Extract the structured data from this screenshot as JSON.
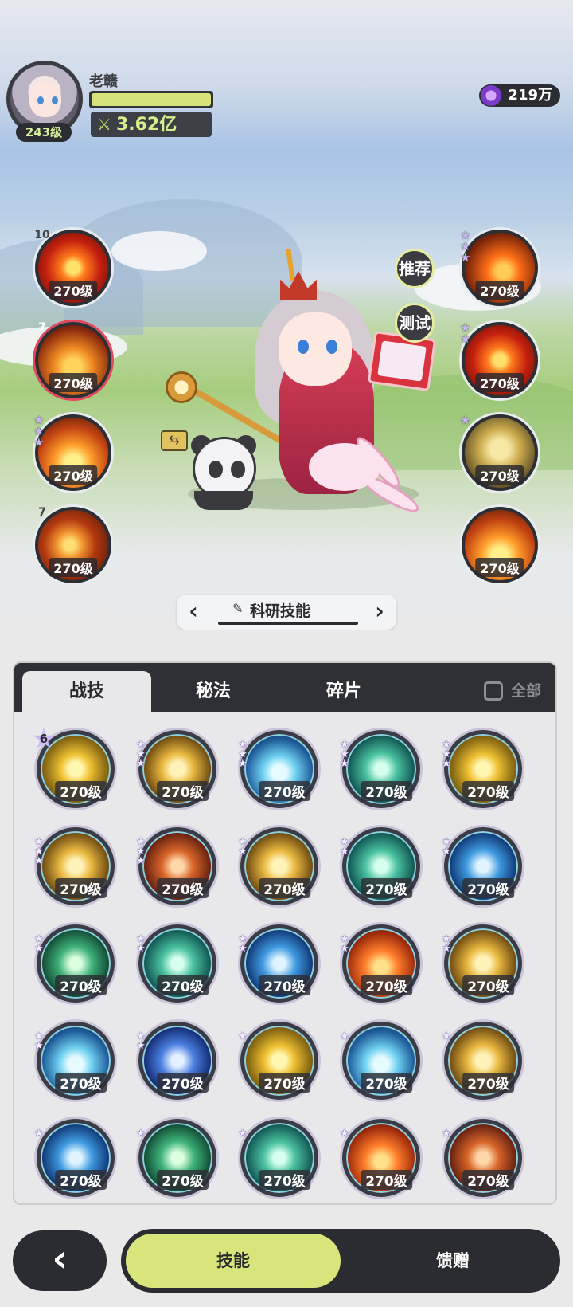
{
  "player": {
    "name": "老赣",
    "level": "243级",
    "power": "3.62亿",
    "currency": "219万"
  },
  "equipped_left": [
    {
      "badge": "10",
      "level": "270级",
      "icon": "fire-burst-icon"
    },
    {
      "badge": "7",
      "level": "270级",
      "icon": "fire-spirit-icon"
    },
    {
      "badge": "",
      "level": "270级",
      "icon": "flame-icon"
    },
    {
      "badge": "7",
      "level": "270级",
      "icon": "fire-vortex-icon"
    }
  ],
  "equipped_right": [
    {
      "level": "270级",
      "icon": "fire-orb-icon"
    },
    {
      "level": "270级",
      "icon": "fire-bird-icon"
    },
    {
      "level": "270级",
      "icon": "shield-icon"
    },
    {
      "level": "270级",
      "icon": "fire-fist-icon"
    }
  ],
  "side_buttons": {
    "recommend": "推荐",
    "test": "测试"
  },
  "switcher": {
    "title": "科研技能",
    "prev": "‹",
    "next": "›"
  },
  "tabs": {
    "items": [
      "战技",
      "秘法",
      "碎片"
    ],
    "active": "战技",
    "all_label": "全部"
  },
  "skills": [
    {
      "badge": "6",
      "level": "270级",
      "icon": "lightning-orb-icon"
    },
    {
      "badge": "",
      "level": "270级",
      "icon": "lightning-dragon-icon"
    },
    {
      "badge": "",
      "level": "270级",
      "icon": "ice-crystal-icon"
    },
    {
      "badge": "",
      "level": "270级",
      "icon": "wind-swirl-icon"
    },
    {
      "badge": "",
      "level": "270级",
      "icon": "star-burst-icon"
    },
    {
      "badge": "",
      "level": "270级",
      "icon": "lightning-strike-icon"
    },
    {
      "badge": "",
      "level": "270级",
      "icon": "meteor-icon"
    },
    {
      "badge": "",
      "level": "270级",
      "icon": "golden-star-icon"
    },
    {
      "badge": "",
      "level": "270级",
      "icon": "wind-arrow-icon"
    },
    {
      "badge": "",
      "level": "270级",
      "icon": "water-wave-icon"
    },
    {
      "badge": "",
      "level": "270级",
      "icon": "green-vortex-icon"
    },
    {
      "badge": "",
      "level": "270级",
      "icon": "wind-orb-icon"
    },
    {
      "badge": "",
      "level": "270级",
      "icon": "water-vortex-icon"
    },
    {
      "badge": "",
      "level": "270级",
      "icon": "fire-wave-icon"
    },
    {
      "badge": "",
      "level": "270级",
      "icon": "light-burst-icon"
    },
    {
      "badge": "",
      "level": "270级",
      "icon": "ice-splash-icon"
    },
    {
      "badge": "",
      "level": "270级",
      "icon": "water-orb-icon"
    },
    {
      "badge": "",
      "level": "270级",
      "icon": "sun-flash-icon"
    },
    {
      "badge": "",
      "level": "270级",
      "icon": "ice-spikes-icon"
    },
    {
      "badge": "",
      "level": "270级",
      "icon": "golden-slash-icon"
    },
    {
      "badge": "",
      "level": "270级",
      "icon": "blue-flame-icon"
    },
    {
      "badge": "",
      "level": "270级",
      "icon": "thorn-vine-icon"
    },
    {
      "badge": "",
      "level": "270级",
      "icon": "teal-spiral-icon"
    },
    {
      "badge": "",
      "level": "270级",
      "icon": "red-flame-icon"
    },
    {
      "badge": "",
      "level": "270级",
      "icon": "ember-swirl-icon"
    }
  ],
  "bottom_nav": {
    "back": "‹",
    "active": "技能",
    "other": "馈赠"
  },
  "colors": {
    "accent": "#d9e57a",
    "dark": "#2a2c32",
    "panel_bg": "#e8e8ea"
  }
}
